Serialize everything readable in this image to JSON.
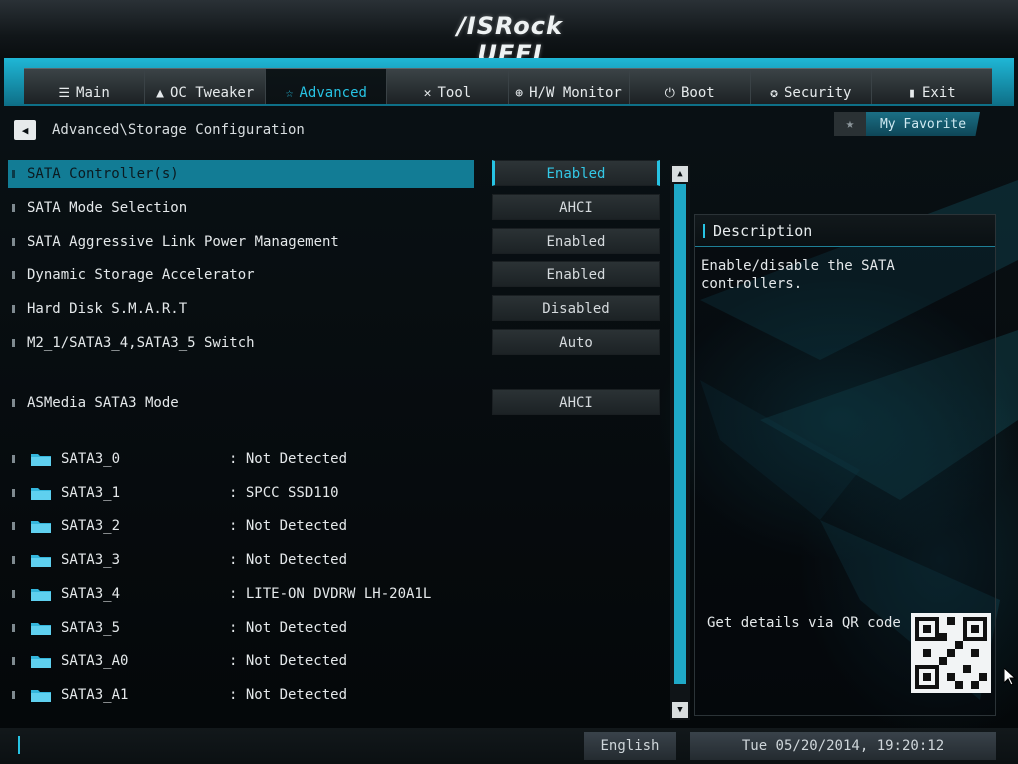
{
  "header": {
    "logo": "/ISRock UEFI"
  },
  "tabs": [
    {
      "label": "Main",
      "icon": "list-icon",
      "glyph": "☰"
    },
    {
      "label": "OC Tweaker",
      "icon": "rocket-icon",
      "glyph": "▲"
    },
    {
      "label": "Advanced",
      "icon": "star-icon",
      "glyph": "☆",
      "active": true
    },
    {
      "label": "Tool",
      "icon": "tool-icon",
      "glyph": "✕"
    },
    {
      "label": "H/W Monitor",
      "icon": "monitor-icon",
      "glyph": "⊕"
    },
    {
      "label": "Boot",
      "icon": "power-icon",
      "glyph": "⏻"
    },
    {
      "label": "Security",
      "icon": "shield-icon",
      "glyph": "✪"
    },
    {
      "label": "Exit",
      "icon": "exit-icon",
      "glyph": "▮"
    }
  ],
  "breadcrumb": {
    "path": "Advanced\\Storage Configuration"
  },
  "favorite": {
    "label": "My Favorite"
  },
  "settings": [
    {
      "label": "SATA Controller(s)",
      "value": "Enabled",
      "selected": true
    },
    {
      "label": "SATA Mode Selection",
      "value": "AHCI"
    },
    {
      "label": "SATA Aggressive Link Power Management",
      "value": "Enabled"
    },
    {
      "label": "Dynamic Storage Accelerator",
      "value": "Enabled"
    },
    {
      "label": "Hard Disk S.M.A.R.T",
      "value": "Disabled"
    },
    {
      "label": "M2_1/SATA3_4,SATA3_5 Switch",
      "value": "Auto"
    },
    {
      "label": "ASMedia SATA3 Mode",
      "value": "AHCI"
    }
  ],
  "ports": [
    {
      "name": "SATA3_0",
      "value": ": Not Detected"
    },
    {
      "name": "SATA3_1",
      "value": ": SPCC SSD110"
    },
    {
      "name": "SATA3_2",
      "value": ": Not Detected"
    },
    {
      "name": "SATA3_3",
      "value": ": Not Detected"
    },
    {
      "name": "SATA3_4",
      "value": ": LITE-ON DVDRW LH-20A1L"
    },
    {
      "name": "SATA3_5",
      "value": ": Not Detected"
    },
    {
      "name": "SATA3_A0",
      "value": ": Not Detected"
    },
    {
      "name": "SATA3_A1",
      "value": ": Not Detected"
    }
  ],
  "description": {
    "title": "Description",
    "text": "Enable/disable the SATA controllers.",
    "qr_label": "Get details via QR code"
  },
  "footer": {
    "language": "English",
    "datetime": "Tue 05/20/2014, 19:20:12"
  },
  "colors": {
    "accent": "#27c3e3",
    "selected_row": "#127c95"
  }
}
